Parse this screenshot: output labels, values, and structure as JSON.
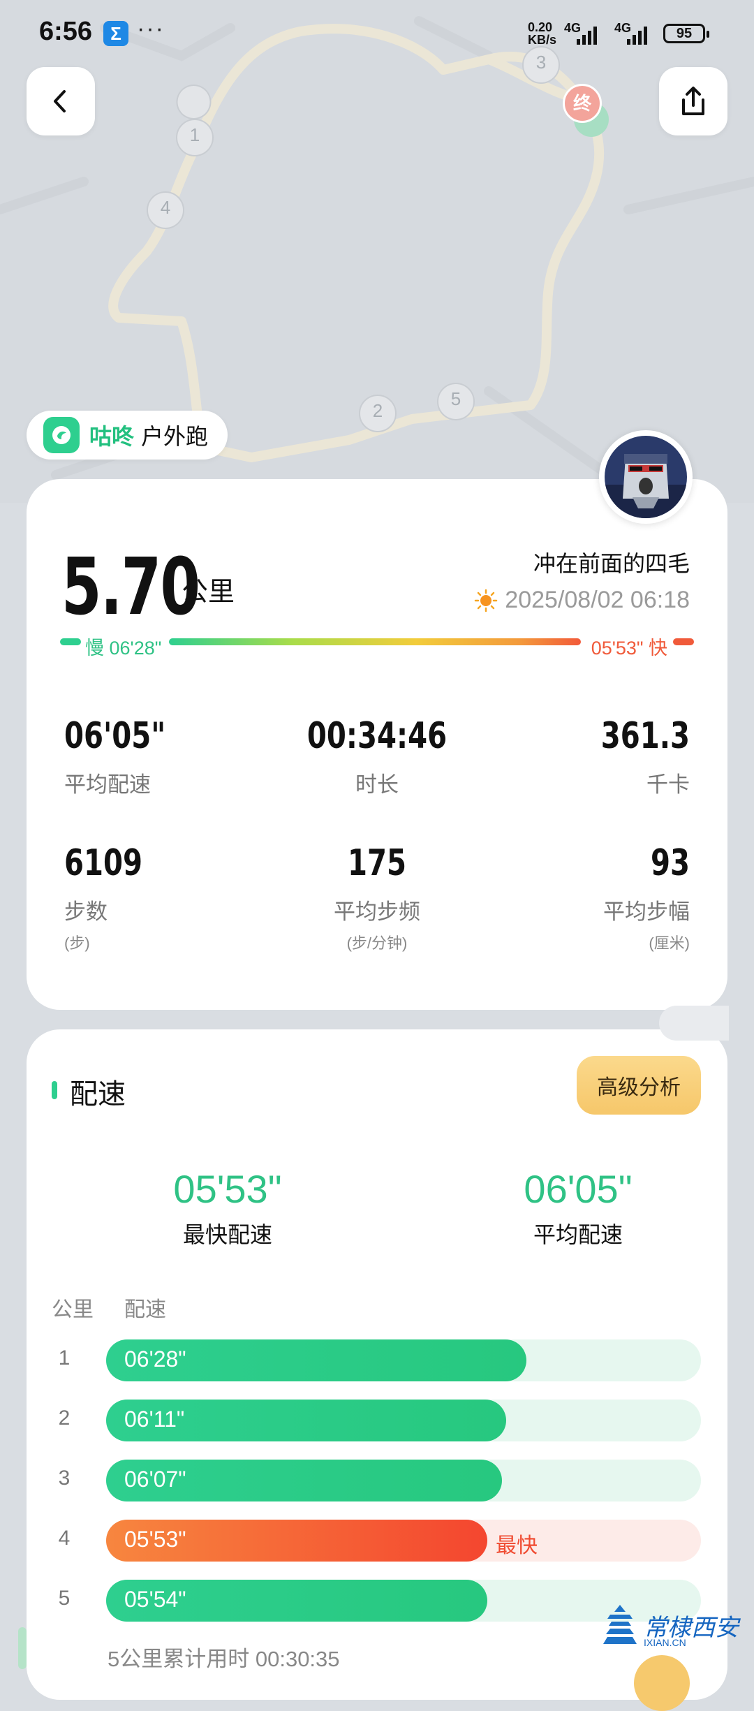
{
  "status_bar": {
    "time": "6:56",
    "app_icon": "Σ",
    "more": "···",
    "net_speed_value": "0.20",
    "net_speed_unit": "KB/s",
    "net_type_1": "4G",
    "net_type_2": "4G",
    "battery": "95"
  },
  "map": {
    "markers": [
      "1",
      "2",
      "3",
      "4",
      "5"
    ],
    "end_marker": "终"
  },
  "brand": {
    "name": "咕咚",
    "activity": "户外跑"
  },
  "summary": {
    "distance": "5.70",
    "distance_unit": "公里",
    "user_name": "冲在前面的四毛",
    "datetime": "2025/08/02 06:18",
    "slow_label": "慢 06'28\"",
    "fast_label": "05'53\" 快"
  },
  "stats": [
    {
      "value": "06'05\"",
      "label": "平均配速",
      "unit": ""
    },
    {
      "value": "00:34:46",
      "label": "时长",
      "unit": ""
    },
    {
      "value": "361.3",
      "label": "千卡",
      "unit": ""
    },
    {
      "value": "6109",
      "label": "步数",
      "unit": "(步)"
    },
    {
      "value": "175",
      "label": "平均步频",
      "unit": "(步/分钟)"
    },
    {
      "value": "93",
      "label": "平均步幅",
      "unit": "(厘米)"
    }
  ],
  "pace_section": {
    "title": "配速",
    "advanced_button": "高级分析",
    "fastest_value": "05'53\"",
    "fastest_label": "最快配速",
    "average_value": "06'05\"",
    "average_label": "平均配速",
    "col_km": "公里",
    "col_pace": "配速",
    "fastest_tag": "最快",
    "splits": [
      {
        "km": "1",
        "pace": "06'28\"",
        "fraction": 0.706,
        "fastest": false
      },
      {
        "km": "2",
        "pace": "06'11\"",
        "fraction": 0.673,
        "fastest": false
      },
      {
        "km": "3",
        "pace": "06'07\"",
        "fraction": 0.665,
        "fastest": false
      },
      {
        "km": "4",
        "pace": "05'53\"",
        "fraction": 0.641,
        "fastest": true
      },
      {
        "km": "5",
        "pace": "05'54\"",
        "fraction": 0.641,
        "fastest": false
      }
    ],
    "summary": "5公里累计用时 00:30:35"
  },
  "watermark": {
    "text": "常棣西安",
    "url": "IXIAN.CN"
  }
}
